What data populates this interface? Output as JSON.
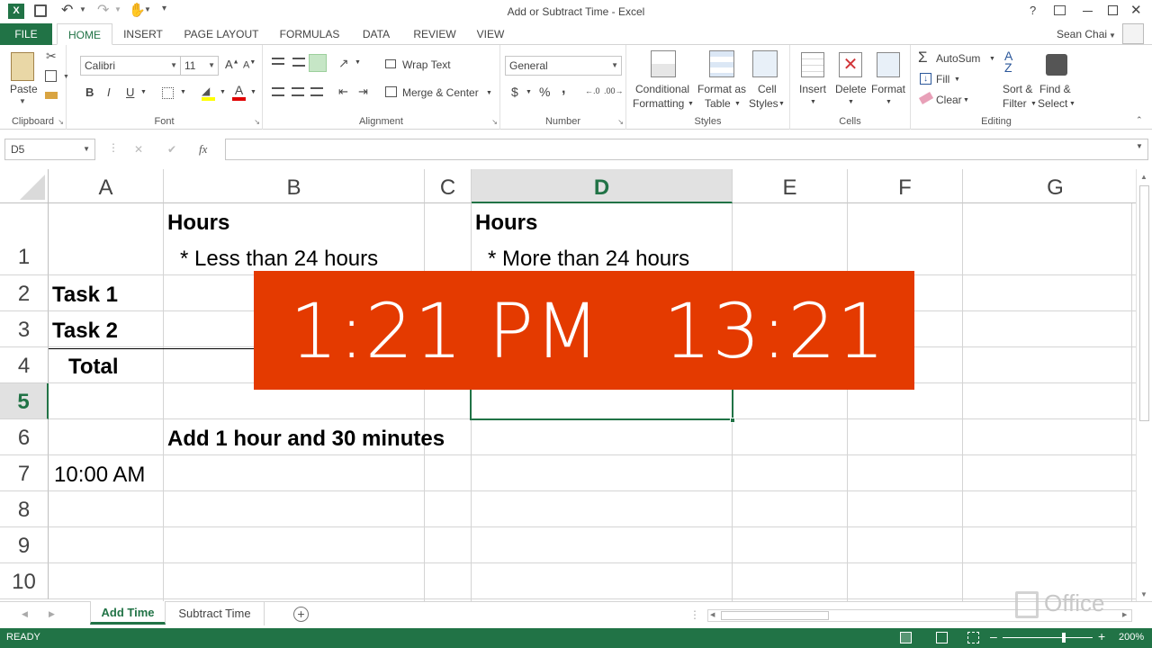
{
  "window": {
    "title": "Add or Subtract Time - Excel",
    "user": "Sean Chai"
  },
  "ribbon_tabs": [
    "FILE",
    "HOME",
    "INSERT",
    "PAGE LAYOUT",
    "FORMULAS",
    "DATA",
    "REVIEW",
    "VIEW"
  ],
  "clipboard": {
    "paste": "Paste",
    "label": "Clipboard"
  },
  "font": {
    "family": "Calibri",
    "size": "11",
    "label": "Font",
    "bold": "B",
    "italic": "I",
    "underline": "U"
  },
  "alignment": {
    "wrap": "Wrap Text",
    "merge": "Merge & Center",
    "label": "Alignment"
  },
  "number": {
    "format": "General",
    "currency": "$",
    "percent": "%",
    "comma": ",",
    "inc": "←.0\n.00",
    "label": "Number"
  },
  "styles": {
    "conditional1": "Conditional",
    "conditional2": "Formatting",
    "format_as1": "Format as",
    "format_as2": "Table",
    "cell_styles1": "Cell",
    "cell_styles2": "Styles",
    "label": "Styles"
  },
  "cells": {
    "insert": "Insert",
    "delete": "Delete",
    "format": "Format",
    "label": "Cells"
  },
  "editing": {
    "autosum": "AutoSum",
    "fill": "Fill",
    "clear": "Clear",
    "sort1": "Sort &",
    "sort2": "Filter",
    "find1": "Find &",
    "find2": "Select",
    "label": "Editing"
  },
  "formula_bar": {
    "name_box": "D5",
    "fx": "fx",
    "cancel": "✕",
    "enter": "✔",
    "value": ""
  },
  "columns": [
    "A",
    "B",
    "C",
    "D",
    "E",
    "F",
    "G"
  ],
  "rows": [
    "1",
    "2",
    "3",
    "4",
    "5",
    "6",
    "7",
    "8",
    "9",
    "10"
  ],
  "cells_data": {
    "B1_title": "Hours",
    "B1_sub": "* Less than 24 hours",
    "D1_title": "Hours",
    "D1_sub": "* More than 24 hours",
    "A2": "Task 1",
    "A3": "Task 2",
    "A4": "Total",
    "B6": "Add 1 hour and 30 minutes",
    "A7": "10:00 AM"
  },
  "overlay": {
    "time12": "1:21 PM",
    "time24": "13:21",
    "color": "#e43a00"
  },
  "sheets": [
    "Add Time",
    "Subtract Time"
  ],
  "status": {
    "mode": "READY",
    "zoom": "200%"
  },
  "watermark": "Office",
  "colors": {
    "accent": "#217346",
    "header_selected": "#217346"
  }
}
